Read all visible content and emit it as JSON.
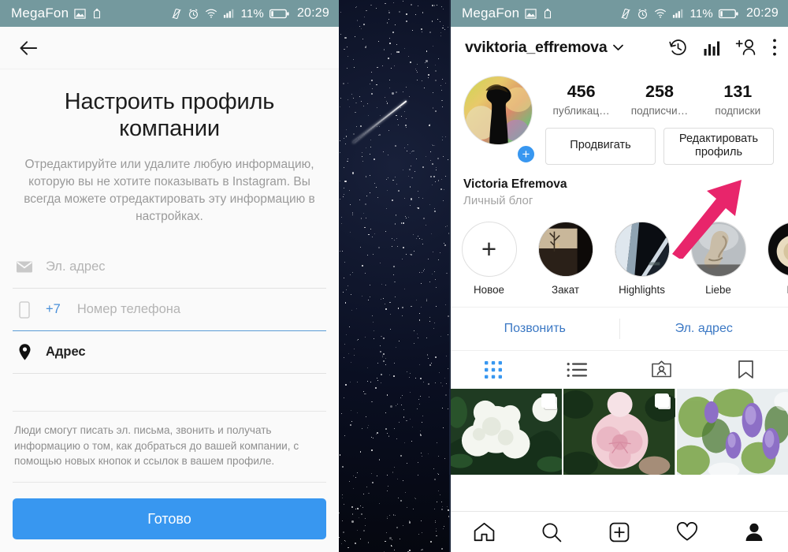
{
  "statusbar": {
    "carrier": "MegaFon",
    "battery_pct": "11%",
    "time": "20:29",
    "icons": [
      "picture-icon",
      "vpn-key-icon",
      "vibrate-icon",
      "alarm-icon",
      "wifi-icon",
      "signal-icon",
      "battery-icon"
    ]
  },
  "left_panel": {
    "back_icon": "back-arrow-icon",
    "title": "Настроить профиль компании",
    "subtitle": "Отредактируйте или удалите любую информацию, которую вы не хотите показывать в Instagram. Вы всегда можете отредактировать эту информацию в настройках.",
    "fields": [
      {
        "icon": "envelope-icon",
        "placeholder": "Эл. адрес",
        "value": "",
        "prefix": "",
        "focused": false
      },
      {
        "icon": "phone-icon",
        "placeholder": "Номер телефона",
        "value": "",
        "prefix": "+7",
        "focused": true
      },
      {
        "icon": "location-pin-icon",
        "placeholder": "",
        "value": "Адрес",
        "prefix": "",
        "focused": false
      }
    ],
    "note": "Люди смогут писать эл. письма, звонить и получать информацию о том, как добраться до вашей компании, с помощью новых кнопок и ссылок в вашем профиле.",
    "done_label": "Готово",
    "done_color": "#3897f0"
  },
  "middle_panel": {
    "name": "night-sky-starfield",
    "description": "meteor-streak"
  },
  "right_panel": {
    "username": "vviktoria_effremova",
    "caret_icon": "chevron-down-icon",
    "header_actions": [
      {
        "name": "archive-history-icon"
      },
      {
        "name": "insights-bar-chart-icon"
      },
      {
        "name": "add-person-icon"
      },
      {
        "name": "overflow-menu-icon"
      }
    ],
    "avatar": {
      "name": "profile-avatar",
      "badge": "+"
    },
    "stats": [
      {
        "num": "456",
        "label": "публикац…"
      },
      {
        "num": "258",
        "label": "подписчи…"
      },
      {
        "num": "131",
        "label": "подписки"
      }
    ],
    "buttons": [
      {
        "label": "Продвигать"
      },
      {
        "label": "Редактировать профиль"
      }
    ],
    "bio": {
      "name": "Victoria Efremova",
      "category": "Личный блог"
    },
    "highlights": [
      {
        "label": "Новое",
        "type": "add"
      },
      {
        "label": "Закат",
        "type": "cover"
      },
      {
        "label": "Highlights",
        "type": "cover"
      },
      {
        "label": "Liebe",
        "type": "cover"
      },
      {
        "label": "Hig",
        "type": "cover"
      }
    ],
    "contact_buttons": [
      {
        "label": "Позвонить"
      },
      {
        "label": "Эл. адрес"
      }
    ],
    "tabs": [
      {
        "name": "grid-tab",
        "icon": "grid-icon",
        "active": true
      },
      {
        "name": "list-tab",
        "icon": "list-icon",
        "active": false
      },
      {
        "name": "tagged-tab",
        "icon": "tagged-person-icon",
        "active": false
      },
      {
        "name": "saved-tab",
        "icon": "bookmark-icon",
        "active": false
      }
    ],
    "tab_active_color": "#3897f0",
    "photos": [
      {
        "name": "white-peony-photo",
        "multi": true
      },
      {
        "name": "pink-peony-photo",
        "multi": true
      },
      {
        "name": "purple-lilac-photo",
        "multi": false
      }
    ],
    "bottom_nav": [
      {
        "name": "home-icon"
      },
      {
        "name": "search-icon"
      },
      {
        "name": "add-post-icon"
      },
      {
        "name": "heart-icon"
      },
      {
        "name": "profile-person-icon"
      }
    ]
  },
  "annotation": {
    "arrow_color": "#e8256b",
    "arrow_name": "pink-pointer-arrow"
  }
}
